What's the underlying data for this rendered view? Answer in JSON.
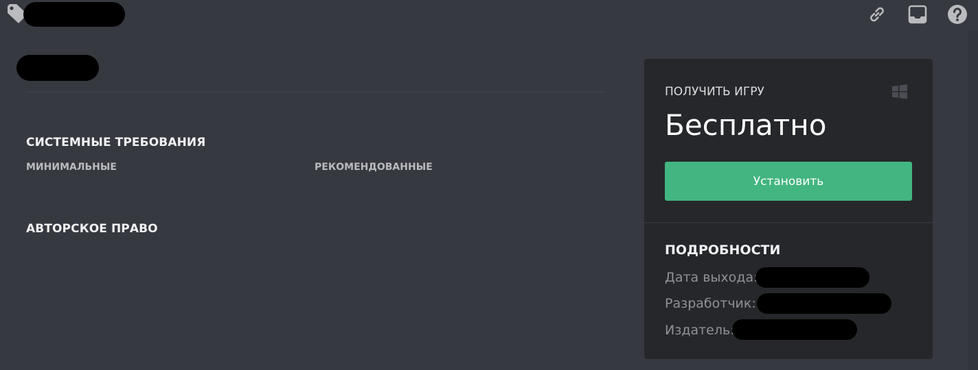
{
  "topbar": {
    "icons": [
      "link-icon",
      "inbox-icon",
      "help-icon"
    ]
  },
  "store": {
    "sections": {
      "system_requirements": "СИСТЕМНЫЕ ТРЕБОВАНИЯ",
      "minimum": "МИНИМАЛЬНЫЕ",
      "recommended": "РЕКОМЕНДОВАННЫЕ",
      "copyright": "АВТОРСКОЕ ПРАВО"
    },
    "purchase": {
      "label": "ПОЛУЧИТЬ ИГРУ",
      "price": "Бесплатно",
      "install_label": "Установить",
      "platform_icon": "windows-icon"
    },
    "details": {
      "title": "ПОДРОБНОСТИ",
      "release_date_label": "Дата выхода:",
      "developer_label": "Разработчик:",
      "publisher_label": "Издатель:"
    }
  },
  "colors": {
    "background": "#36393f",
    "panel": "#26272b",
    "accent_green": "#43b581",
    "text_primary": "#f0f1f2",
    "text_muted": "#8e9297"
  }
}
